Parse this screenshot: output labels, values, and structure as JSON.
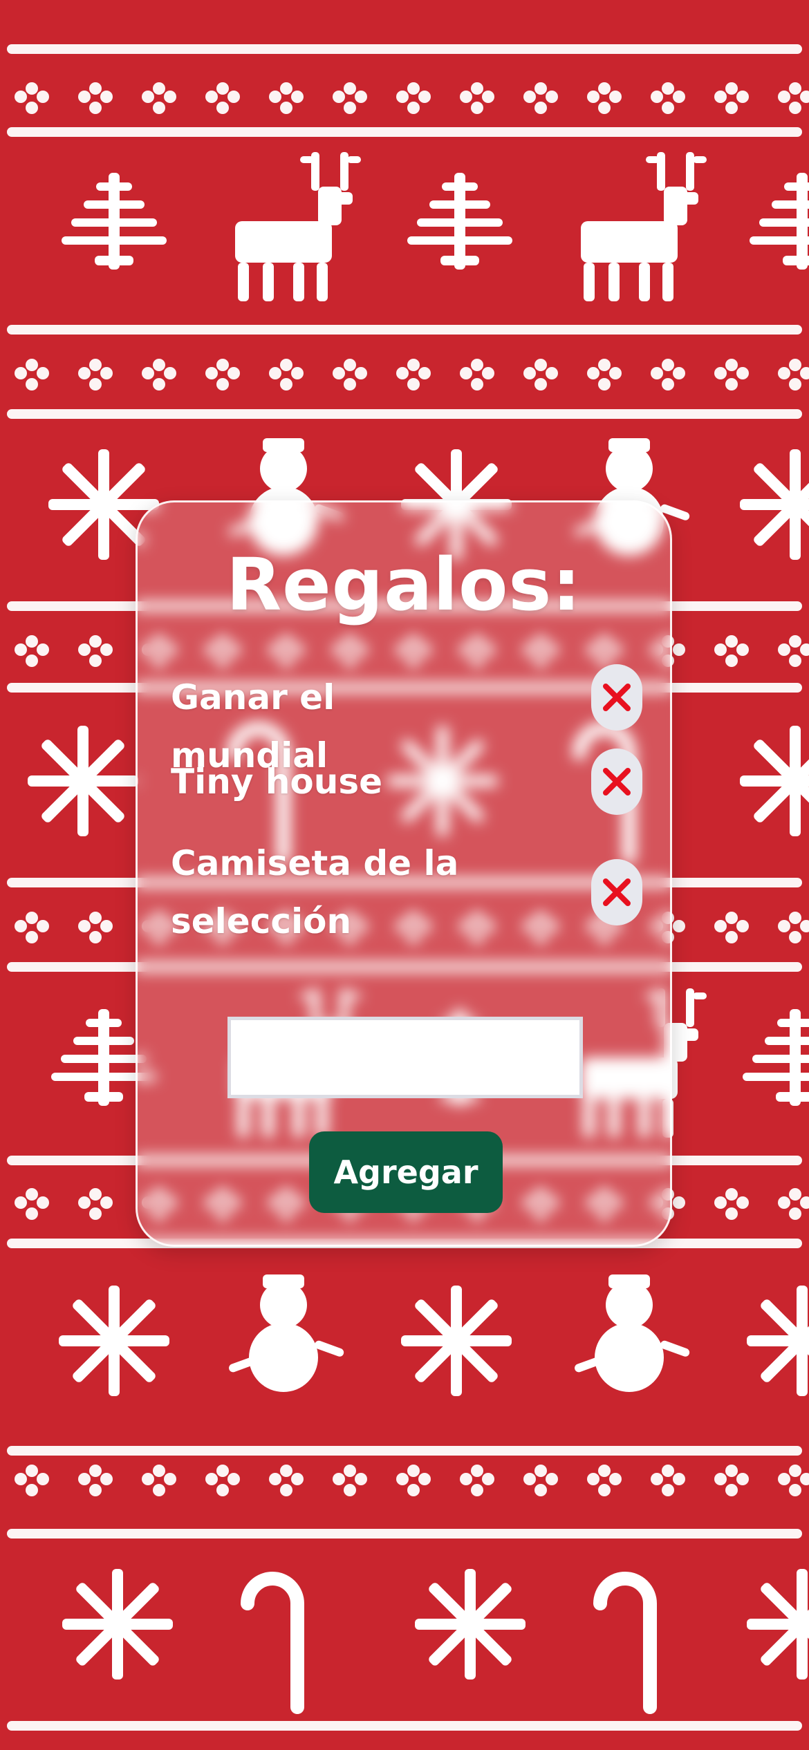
{
  "background": {
    "color": "#c9252e",
    "pattern_color": "#ffffff",
    "pattern": "ugly-christmas-sweater"
  },
  "card": {
    "title": "Regalos:",
    "items": [
      {
        "text": "Ganar el mundial",
        "delete_icon": "x-icon"
      },
      {
        "text": "Tiny house",
        "delete_icon": "x-icon"
      },
      {
        "text": "Camiseta de la selección",
        "delete_icon": "x-icon"
      }
    ],
    "input": {
      "value": "",
      "placeholder": ""
    },
    "add_button_label": "Agregar",
    "colors": {
      "add_button": "#0d5c40",
      "delete_icon": "#e8101f",
      "delete_button_bg": "#e7e8ee"
    }
  }
}
